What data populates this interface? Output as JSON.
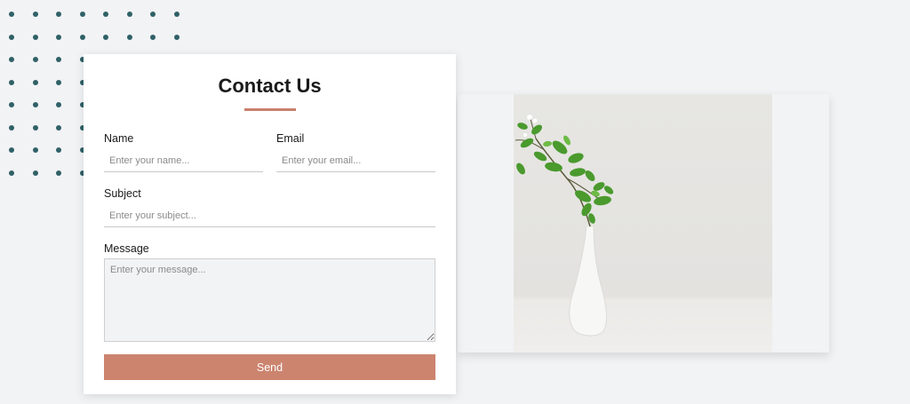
{
  "colors": {
    "accent": "#cc846f",
    "dots": "#2f6167",
    "background": "#f2f3f5"
  },
  "contact_form": {
    "title": "Contact Us",
    "name": {
      "label": "Name",
      "placeholder": "Enter your name..."
    },
    "email": {
      "label": "Email",
      "placeholder": "Enter your email..."
    },
    "subject": {
      "label": "Subject",
      "placeholder": "Enter your subject..."
    },
    "message": {
      "label": "Message",
      "placeholder": "Enter your message..."
    },
    "send_label": "Send"
  },
  "decoration": {
    "image_subject": "white vase with green leafy branch"
  }
}
